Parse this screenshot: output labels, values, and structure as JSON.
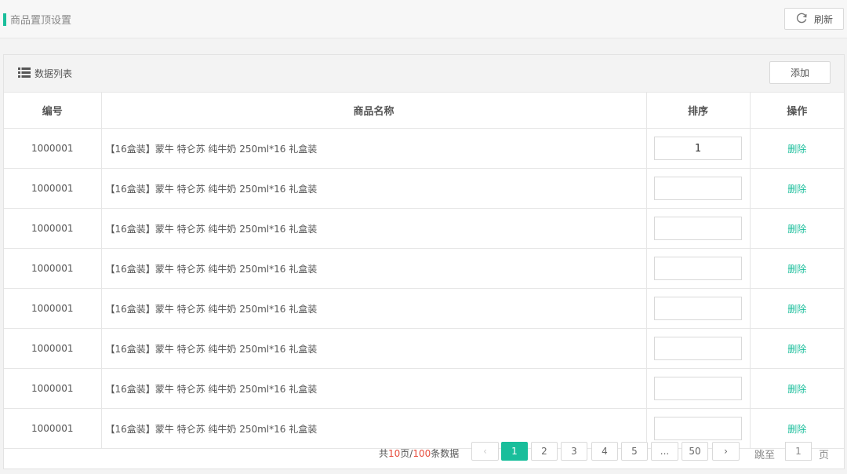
{
  "header": {
    "title": "商品置顶设置",
    "refresh_label": "刷新"
  },
  "panel": {
    "list_title": "数据列表",
    "add_label": "添加"
  },
  "table": {
    "columns": [
      "编号",
      "商品名称",
      "排序",
      "操作"
    ],
    "rows": [
      {
        "id": "1000001",
        "name": "【16盒装】蒙牛 特仑苏 纯牛奶 250ml*16 礼盒装",
        "sort": "1",
        "action": "删除"
      },
      {
        "id": "1000001",
        "name": "【16盒装】蒙牛 特仑苏 纯牛奶 250ml*16 礼盒装",
        "sort": "",
        "action": "删除"
      },
      {
        "id": "1000001",
        "name": "【16盒装】蒙牛 特仑苏 纯牛奶 250ml*16 礼盒装",
        "sort": "",
        "action": "删除"
      },
      {
        "id": "1000001",
        "name": "【16盒装】蒙牛 特仑苏 纯牛奶 250ml*16 礼盒装",
        "sort": "",
        "action": "删除"
      },
      {
        "id": "1000001",
        "name": "【16盒装】蒙牛 特仑苏 纯牛奶 250ml*16 礼盒装",
        "sort": "",
        "action": "删除"
      },
      {
        "id": "1000001",
        "name": "【16盒装】蒙牛 特仑苏 纯牛奶 250ml*16 礼盒装",
        "sort": "",
        "action": "删除"
      },
      {
        "id": "1000001",
        "name": "【16盒装】蒙牛 特仑苏 纯牛奶 250ml*16 礼盒装",
        "sort": "",
        "action": "删除"
      },
      {
        "id": "1000001",
        "name": "【16盒装】蒙牛 特仑苏 纯牛奶 250ml*16 礼盒装",
        "sort": "",
        "action": "删除"
      }
    ]
  },
  "pagination": {
    "summary_prefix": "共",
    "total_pages": "10",
    "summary_mid": "页/",
    "total_records": "100",
    "summary_suffix": "条数据",
    "prev": "‹",
    "next": "›",
    "pages": [
      "1",
      "2",
      "3",
      "4",
      "5",
      "...",
      "50"
    ],
    "current_page": "1",
    "jump_label": "跳至",
    "jump_value": "1",
    "page_unit": "页"
  },
  "colors": {
    "accent": "#19be9b",
    "highlight": "#e74c3c"
  },
  "icons": {
    "refresh": "refresh-icon",
    "list": "list-icon"
  }
}
